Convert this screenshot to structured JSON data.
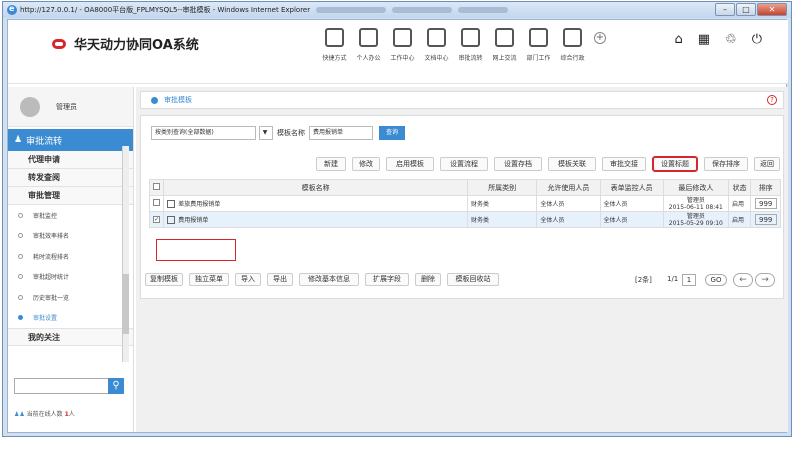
{
  "window": {
    "title": "http://127.0.0.1/ - OA8000平台版_FPLMYSQL5--审批模板 - Windows Internet Explorer",
    "minimize": "–",
    "maximize": "□",
    "close": "✕"
  },
  "header": {
    "app_name": "华天动力协同OA系统",
    "nav": [
      {
        "label": "快捷方式",
        "icon": "send-icon"
      },
      {
        "label": "个人办公",
        "icon": "person-icon"
      },
      {
        "label": "工作中心",
        "icon": "briefcase-icon"
      },
      {
        "label": "文档中心",
        "icon": "inbox-icon"
      },
      {
        "label": "审批流转",
        "icon": "flow-icon"
      },
      {
        "label": "网上交流",
        "icon": "chat-icon"
      },
      {
        "label": "部门工作",
        "icon": "calendar-icon"
      },
      {
        "label": "综合行政",
        "icon": "building-icon"
      }
    ],
    "add": "+",
    "home": "⌂",
    "grid": "▦",
    "skin": "♲",
    "power": "⏻"
  },
  "sidebar": {
    "user": "管理员",
    "section": "审批流转",
    "groups": [
      "代理申请",
      "转发查阅",
      "审批管理"
    ],
    "sub_items": [
      "审批监控",
      "审批效率排名",
      "耗时流程排名",
      "审批超时统计",
      "历史审批一览",
      "审批设置"
    ],
    "active_sub": 5,
    "my_attention": "我的关注",
    "search_placeholder": "",
    "search_icon": "⚲",
    "online_prefix": "当前在线人数",
    "online_count": "1",
    "online_suffix": "人"
  },
  "breadcrumb": {
    "label": "审批模板",
    "help": "?"
  },
  "filter": {
    "category_select": "按类别查询(全部数据)",
    "arrow": "▼",
    "name_label": "模板名称",
    "name_value": "费用报销单",
    "query": "查询"
  },
  "toolbar": [
    "新建",
    "修改",
    "启用模板",
    "设置流程",
    "设置存档",
    "模板关联",
    "审批交接",
    "设置标题",
    "保存排序",
    "返回"
  ],
  "table": {
    "headers": [
      "模板名称",
      "所属类别",
      "允许使用人员",
      "表单监控人员",
      "最后修改人",
      "状态",
      "排序"
    ],
    "rows": [
      {
        "checked": "",
        "name": "差旅费用报销单",
        "category": "财务类",
        "allowed": "全体人员",
        "monitor": "全体人员",
        "modifier": "管理员",
        "date": "2015-06-11 08:41",
        "status": "启用",
        "order": "999"
      },
      {
        "checked": "✓",
        "name": "费用报销单",
        "category": "财务类",
        "allowed": "全体人员",
        "monitor": "全体人员",
        "modifier": "管理员",
        "date": "2015-05-29 09:10",
        "status": "启用",
        "order": "999"
      }
    ]
  },
  "bottom": {
    "buttons": [
      "复制模板",
      "独立菜单",
      "导入",
      "导出",
      "修改基本信息",
      "扩展字段",
      "删除",
      "模板回收站"
    ],
    "count": "[2条]",
    "page_label": "1/1",
    "page_value": "1",
    "go": "GO",
    "prev": "←",
    "next": "→"
  }
}
